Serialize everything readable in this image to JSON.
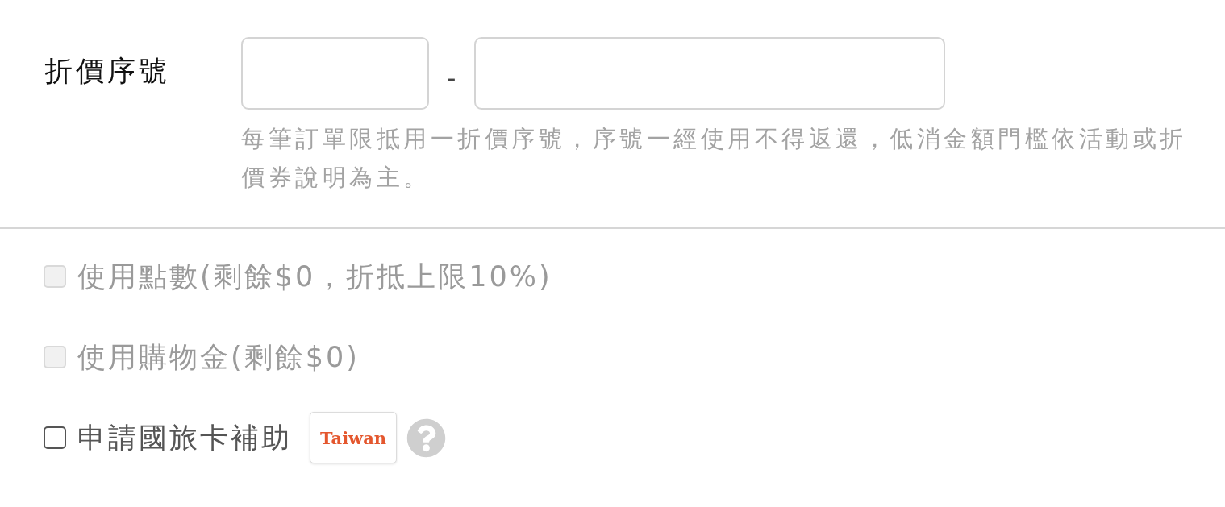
{
  "coupon": {
    "label": "折價序號",
    "separator": "-",
    "hint": "每筆訂單限抵用一折價序號，序號一經使用不得返還，低消金額門檻依活動或折價券說明為主。"
  },
  "options": [
    {
      "kind": "checkbox",
      "label": "使用點數(剩餘$0，折抵上限10%)",
      "checked": false,
      "disabled": true
    },
    {
      "kind": "checkbox",
      "label": "使用購物金(剩餘$0)",
      "checked": false,
      "disabled": true
    },
    {
      "kind": "checkbox",
      "label": "申請國旅卡補助",
      "checked": false,
      "disabled": false,
      "logo": {
        "text": "Taiwan"
      },
      "help": true
    }
  ]
}
